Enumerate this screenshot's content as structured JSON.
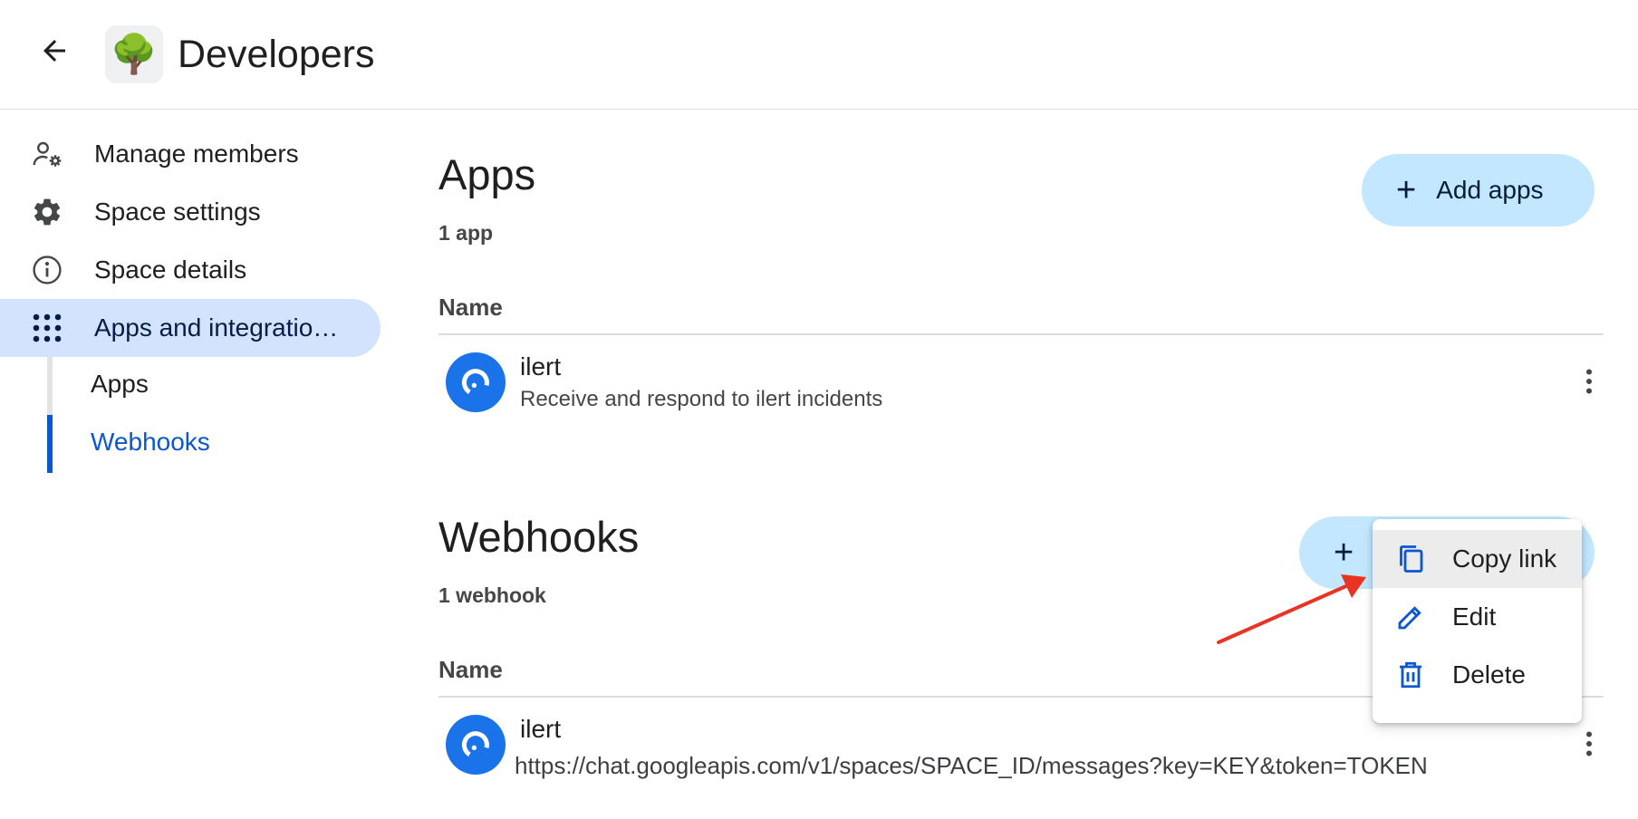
{
  "header": {
    "title": "Developers",
    "avatar_emoji": "🌳"
  },
  "sidebar": {
    "items": [
      {
        "label": "Manage members",
        "icon": "manage-members-icon"
      },
      {
        "label": "Space settings",
        "icon": "gear-icon"
      },
      {
        "label": "Space details",
        "icon": "info-icon"
      },
      {
        "label": "Apps and integratio…",
        "icon": "apps-grid-icon",
        "active": true
      }
    ],
    "subitems": [
      {
        "label": "Apps"
      },
      {
        "label": "Webhooks",
        "active": true
      }
    ]
  },
  "apps_section": {
    "title": "Apps",
    "count": "1 app",
    "add_label": "Add apps",
    "column_header": "Name",
    "rows": [
      {
        "name": "ilert",
        "description": "Receive and respond to ilert incidents"
      }
    ]
  },
  "webhooks_section": {
    "title": "Webhooks",
    "count": "1 webhook",
    "add_label": "+",
    "column_header": "Name",
    "rows": [
      {
        "name": "ilert",
        "url": "https://chat.googleapis.com/v1/spaces/SPACE_ID/messages?key=KEY&token=TOKEN"
      }
    ]
  },
  "context_menu": {
    "items": [
      {
        "label": "Copy link",
        "icon": "copy-icon",
        "hovered": true
      },
      {
        "label": "Edit",
        "icon": "pencil-icon"
      },
      {
        "label": "Delete",
        "icon": "trash-icon"
      }
    ]
  },
  "colors": {
    "accent": "#0b57d0",
    "active_nav_bg": "#d3e3fd",
    "button_bg": "#c2e7ff",
    "annotation_arrow": "#ea3323",
    "app_avatar": "#1a73e8"
  }
}
